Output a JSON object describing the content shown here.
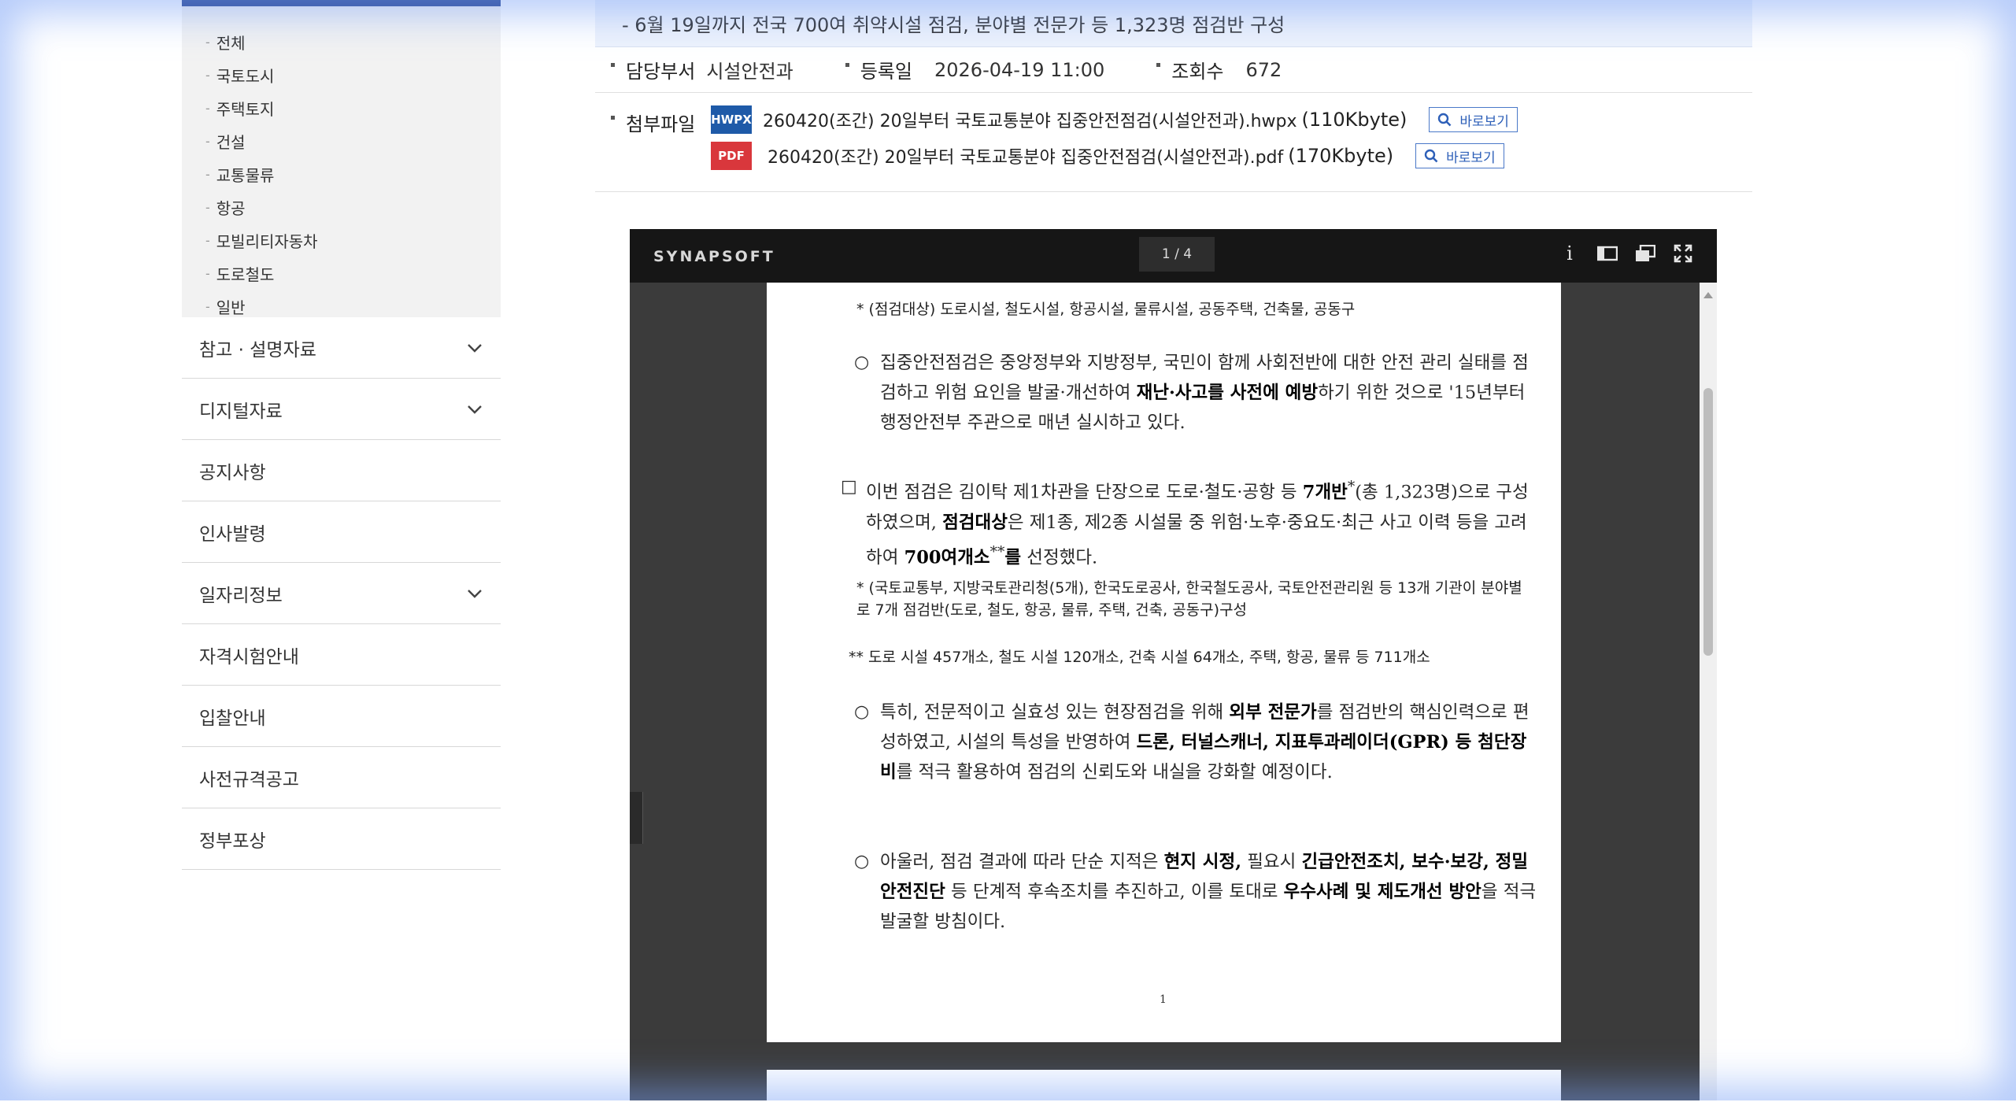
{
  "sidebar": {
    "submenu": [
      "전체",
      "국토도시",
      "주택토지",
      "건설",
      "교통물류",
      "항공",
      "모빌리티자동차",
      "도로철도",
      "일반"
    ],
    "menu": [
      {
        "label": "참고 · 설명자료",
        "expandable": true
      },
      {
        "label": "디지털자료",
        "expandable": true
      },
      {
        "label": "공지사항",
        "expandable": false
      },
      {
        "label": "인사발령",
        "expandable": false
      },
      {
        "label": "일자리정보",
        "expandable": true
      },
      {
        "label": "자격시험안내",
        "expandable": false
      },
      {
        "label": "입찰안내",
        "expandable": false
      },
      {
        "label": "사전규격공고",
        "expandable": false
      },
      {
        "label": "정부포상",
        "expandable": false
      }
    ]
  },
  "article": {
    "summary": "- 6월 19일까지 전국 700여 취약시설 점검, 분야별 전문가 등 1,323명 점검반 구성",
    "meta": {
      "dept_label": "담당부서",
      "dept_value": "시설안전과",
      "date_label": "등록일",
      "date_value": "2026-04-19 11:00",
      "views_label": "조회수",
      "views_value": "672"
    },
    "attachments_label": "첨부파일",
    "attachments": [
      {
        "type": "HWPX",
        "name": "260420(조간) 20일부터 국토교통분야 집중안전점검(시설안전과).hwpx",
        "size": "(110Kbyte)",
        "view": "바로보기"
      },
      {
        "type": "PDF",
        "name": "260420(조간) 20일부터 국토교통분야 집중안전점검(시설안전과).pdf",
        "size": "(170Kbyte)",
        "view": "바로보기"
      }
    ]
  },
  "viewer": {
    "brand": "SYNAPSOFT",
    "page_indicator": "1 / 4",
    "info_glyph": "i",
    "colors": {
      "toolbar": "#161616",
      "background": "#3b3b3b"
    }
  },
  "document": {
    "note_top": "* (점검대상) 도로시설, 철도시설, 항공시설, 물류시설, 공동주택, 건축물, 공동구",
    "p1": {
      "marker": "○",
      "a": "집중안전점검은 중앙정부와 지방정부, 국민이 함께 사회전반에 대한 안전 관리 실태를 점검하고 위험 요인을 발굴·개선하여 ",
      "b": "재난·사고를 사전에 예방",
      "c": "하기 위한 것으로 '15년부터 행정안전부 주관으로 매년 실시하고 있다."
    },
    "p2": {
      "marker": "□",
      "a": "이번 점검은 김이탁 제1차관을 단장으로 도로·철도·공항 등 ",
      "b": "7개반",
      "sup": "*",
      "c": "(총 1,323명)으로 구성하였으며, ",
      "d": "점검대상",
      "e": "은 제1종, 제2종 시설물 중 위험·노후·중요도·최근 사고 이력 등을 고려하여 ",
      "f": "700여개소",
      "sup2": "**",
      "g": "를",
      "h": " 선정했다."
    },
    "note1": "* (국토교통부, 지방국토관리청(5개), 한국도로공사, 한국철도공사, 국토안전관리원 등 13개 기관이 분야별로 7개 점검반(도로, 철도, 항공, 물류, 주택, 건축, 공동구)구성",
    "note2": "** 도로 시설 457개소, 철도 시설 120개소, 건축 시설 64개소, 주택, 항공, 물류 등 711개소",
    "p3": {
      "marker": "○",
      "a": "특히, 전문적이고 실효성 있는 현장점검을 위해 ",
      "b": "외부 전문가",
      "c": "를 점검반의 핵심인력으로 편성하였고, 시설의 특성을 반영하여 ",
      "d": "드론, 터널스캐너, 지표투과레이더(GPR) 등 첨단장비",
      "e": "를 적극 활용하여 점검의 신뢰도와 내실을 강화할 예정이다."
    },
    "p4": {
      "marker": "○",
      "a": "아울러, 점검 결과에 따라 단순 지적은 ",
      "b": "현지 시정,",
      "c": " 필요시 ",
      "d": "긴급안전조치, 보수·보강, 정밀안전진단",
      "e": " 등 단계적 후속조치를 추진하고, 이를 토대로 ",
      "f": "우수사례 및 제도개선 방안",
      "g": "을 적극 발굴할 방침이다."
    },
    "page_number": "1"
  }
}
